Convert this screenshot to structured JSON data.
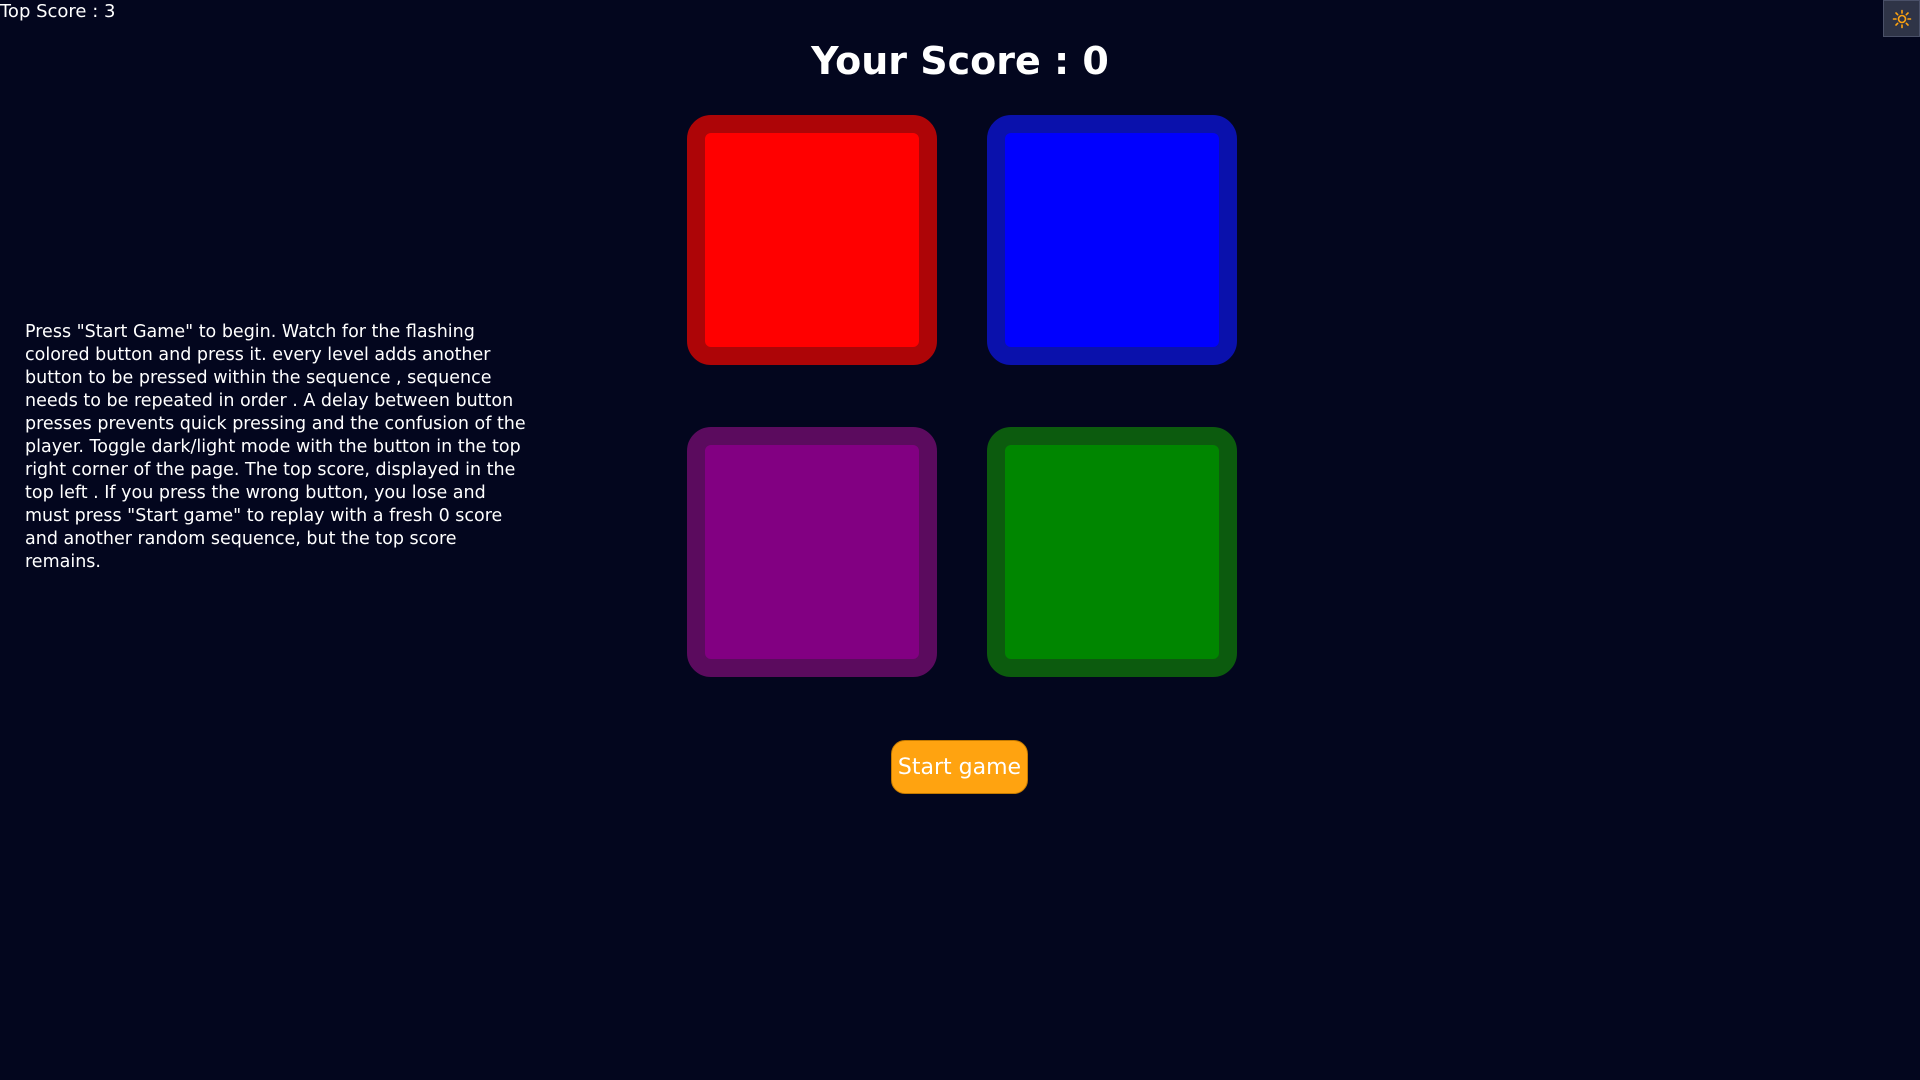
{
  "top_score": {
    "label": "Top Score : 3"
  },
  "theme_toggle": {
    "icon": "sun-icon",
    "color": "#ffa310"
  },
  "score": {
    "label": "Your Score : 0"
  },
  "instructions": {
    "text": "Press \"Start Game\" to begin. Watch for the flashing colored button and press it. every level adds another button to be pressed within the sequence , sequence needs to be repeated in order . A delay between button presses prevents quick pressing and the confusion of the player. Toggle dark/light mode with the button in the top right corner of the page. The top score, displayed in the top left . If you press the wrong button, you lose and must press \"Start game\" to replay with a fresh 0 score and another random sequence, but the top score remains."
  },
  "pads": [
    {
      "name": "red",
      "fill": "#ff0000",
      "border": "#ad0507"
    },
    {
      "name": "blue",
      "fill": "#0000ff",
      "border": "#0a11ac"
    },
    {
      "name": "purple",
      "fill": "#820082",
      "border": "#5b0b5e"
    },
    {
      "name": "green",
      "fill": "#008600",
      "border": "#0c5b0e"
    }
  ],
  "start_button": {
    "label": "Start game",
    "color": "#ffa310"
  },
  "background_color": "#03061e"
}
